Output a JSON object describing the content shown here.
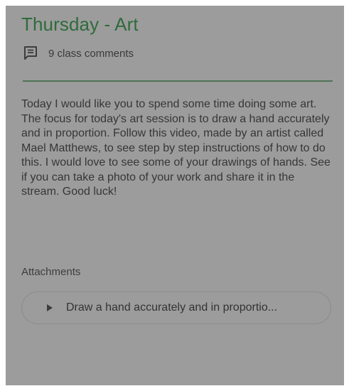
{
  "assignment": {
    "title": "Thursday - Art",
    "comment_icon": "comment-icon",
    "comments_label": "9 class comments",
    "accent_color": "#2f6b3c",
    "description": "Today I would like you to spend some time doing some art. The focus for today's art session is to draw a hand accurately and in proportion. Follow this video, made by an artist called Mael Matthews, to see step by step instructions of how to do this. I would love to see some of your drawings of hands. See if you can take a photo of your work and share it in the stream. Good luck!"
  },
  "attachments": {
    "label": "Attachments",
    "items": [
      {
        "icon": "play-icon",
        "title": "Draw a hand accurately and in proportio..."
      }
    ]
  }
}
